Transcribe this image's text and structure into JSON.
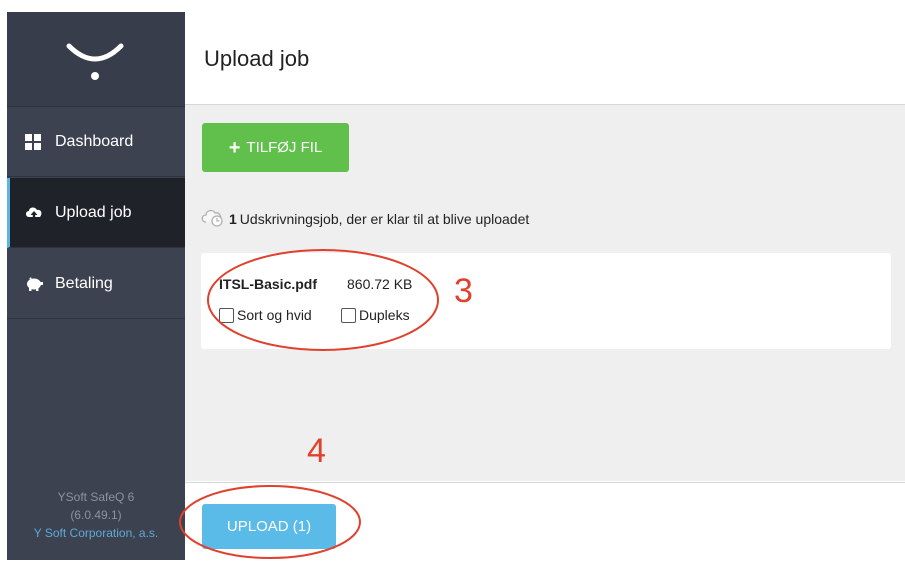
{
  "sidebar": {
    "logo_icon": "ysoft-logo-icon",
    "items": [
      {
        "label": "Dashboard",
        "icon": "grid-icon"
      },
      {
        "label": "Upload job",
        "icon": "cloud-upload-icon"
      },
      {
        "label": "Betaling",
        "icon": "piggy-bank-icon"
      }
    ],
    "footer": {
      "product": "YSoft SafeQ 6",
      "version": "(6.0.49.1)",
      "company": "Y Soft Corporation, a.s."
    }
  },
  "header": {
    "title": "Upload job"
  },
  "content": {
    "add_button_label": "TILFØJ FIL",
    "status": {
      "count": "1",
      "text": "Udskrivningsjob, der er klar til at blive uploadet"
    },
    "file": {
      "name": "ITSL-Basic.pdf",
      "size": "860.72 KB",
      "options": [
        {
          "label": "Sort og hvid",
          "checked": false
        },
        {
          "label": "Dupleks",
          "checked": false
        }
      ]
    }
  },
  "footer": {
    "upload_button_label": "UPLOAD (1)"
  },
  "annotations": {
    "label_3": "3",
    "label_4": "4"
  },
  "colors": {
    "sidebar": "#3c4250",
    "active_nav": "#1f2329",
    "active_accent": "#5bb5e3",
    "add_button": "#61c04b",
    "upload_button": "#5bbbe8",
    "annotation": "#e0412c"
  }
}
